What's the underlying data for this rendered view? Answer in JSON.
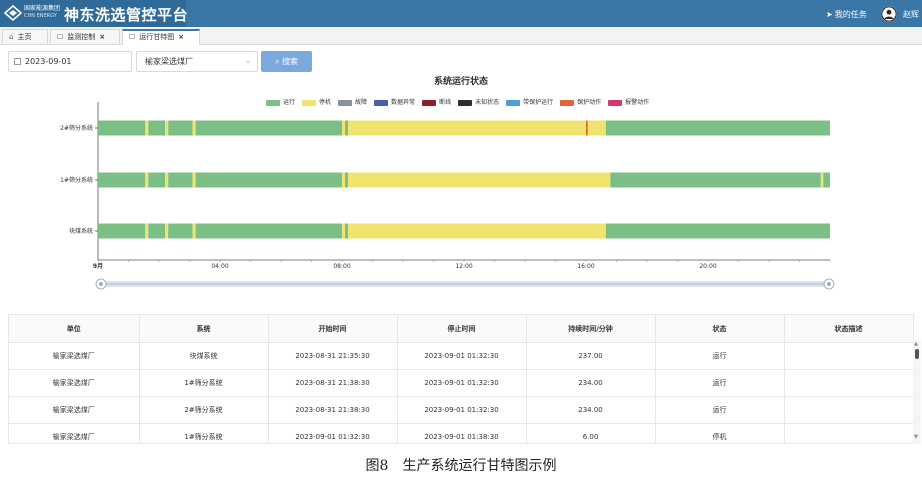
{
  "header": {
    "logo_cn": "国家能源集团",
    "logo_en": "CHN ENERGY",
    "app_title": "神东洗选管控平台",
    "tasks_label": "我的任务",
    "username": "赵辉"
  },
  "tabs": [
    {
      "label": "主页",
      "icon": "home-icon",
      "closable": false,
      "active": false
    },
    {
      "label": "监测控制",
      "icon": "page-icon",
      "closable": true,
      "active": false
    },
    {
      "label": "运行甘特图",
      "icon": "page-icon",
      "closable": true,
      "active": true
    }
  ],
  "filters": {
    "date_value": "2023-09-01",
    "plant_value": "榆家梁选煤厂",
    "search_label": "搜索"
  },
  "colors": {
    "header_bg": "#3a77a7",
    "running": "#7bbf86",
    "stopped": "#f0e36e",
    "fault": "#8a9299",
    "data_error": "#4a5ea8",
    "broken_line": "#8b1c2c",
    "unknown": "#2e2e33",
    "protect_running": "#4a9fdc",
    "protect_action": "#e0633a",
    "alarm_action": "#d13a6a",
    "button": "#79a9dd"
  },
  "chart_data": {
    "type": "gantt",
    "title": "系统运行状态",
    "legend": [
      {
        "name": "运行",
        "color": "#7bbf86"
      },
      {
        "name": "停机",
        "color": "#f0e36e"
      },
      {
        "name": "故障",
        "color": "#8a9299"
      },
      {
        "name": "数据异常",
        "color": "#4a5ea8"
      },
      {
        "name": "断线",
        "color": "#8b1c2c"
      },
      {
        "name": "未知状态",
        "color": "#2e2e33"
      },
      {
        "name": "带保护运行",
        "color": "#4a9fdc"
      },
      {
        "name": "保护动作",
        "color": "#e0633a"
      },
      {
        "name": "报警动作",
        "color": "#d13a6a"
      }
    ],
    "x_range_hours": [
      0,
      24
    ],
    "x_ticks": [
      {
        "hour": 0,
        "label": "9月"
      },
      {
        "hour": 4,
        "label": "04:00"
      },
      {
        "hour": 8,
        "label": "08:00"
      },
      {
        "hour": 12,
        "label": "12:00"
      },
      {
        "hour": 16,
        "label": "16:00"
      },
      {
        "hour": 20,
        "label": "20:00"
      }
    ],
    "systems": [
      {
        "name": "2#筛分系统",
        "segments": [
          {
            "start": 0,
            "end": 1.55,
            "status": "running"
          },
          {
            "start": 1.55,
            "end": 1.65,
            "status": "stopped"
          },
          {
            "start": 1.65,
            "end": 2.2,
            "status": "running"
          },
          {
            "start": 2.2,
            "end": 2.3,
            "status": "stopped"
          },
          {
            "start": 2.3,
            "end": 3.1,
            "status": "running"
          },
          {
            "start": 3.1,
            "end": 3.2,
            "status": "stopped"
          },
          {
            "start": 3.2,
            "end": 8.0,
            "status": "running"
          },
          {
            "start": 8.0,
            "end": 8.1,
            "status": "stopped"
          },
          {
            "start": 8.1,
            "end": 8.2,
            "status": "running"
          },
          {
            "start": 8.2,
            "end": 16.0,
            "status": "stopped"
          },
          {
            "start": 16.0,
            "end": 16.06,
            "status": "protect_action"
          },
          {
            "start": 16.06,
            "end": 16.65,
            "status": "stopped"
          },
          {
            "start": 16.65,
            "end": 24.0,
            "status": "running"
          }
        ]
      },
      {
        "name": "1#筛分系统",
        "segments": [
          {
            "start": 0,
            "end": 1.55,
            "status": "running"
          },
          {
            "start": 1.55,
            "end": 1.65,
            "status": "stopped"
          },
          {
            "start": 1.65,
            "end": 2.2,
            "status": "running"
          },
          {
            "start": 2.2,
            "end": 2.3,
            "status": "stopped"
          },
          {
            "start": 2.3,
            "end": 3.1,
            "status": "running"
          },
          {
            "start": 3.1,
            "end": 3.2,
            "status": "stopped"
          },
          {
            "start": 3.2,
            "end": 8.0,
            "status": "running"
          },
          {
            "start": 8.0,
            "end": 8.1,
            "status": "stopped"
          },
          {
            "start": 8.1,
            "end": 8.2,
            "status": "running"
          },
          {
            "start": 8.2,
            "end": 16.8,
            "status": "stopped"
          },
          {
            "start": 16.8,
            "end": 23.7,
            "status": "running"
          },
          {
            "start": 23.7,
            "end": 23.78,
            "status": "stopped"
          },
          {
            "start": 23.78,
            "end": 24.0,
            "status": "running"
          }
        ]
      },
      {
        "name": "块煤系统",
        "segments": [
          {
            "start": 0,
            "end": 1.55,
            "status": "running"
          },
          {
            "start": 1.55,
            "end": 1.65,
            "status": "stopped"
          },
          {
            "start": 1.65,
            "end": 2.2,
            "status": "running"
          },
          {
            "start": 2.2,
            "end": 2.3,
            "status": "stopped"
          },
          {
            "start": 2.3,
            "end": 3.1,
            "status": "running"
          },
          {
            "start": 3.1,
            "end": 3.2,
            "status": "stopped"
          },
          {
            "start": 3.2,
            "end": 8.0,
            "status": "running"
          },
          {
            "start": 8.0,
            "end": 8.1,
            "status": "stopped"
          },
          {
            "start": 8.1,
            "end": 8.2,
            "status": "running"
          },
          {
            "start": 8.2,
            "end": 16.65,
            "status": "stopped"
          },
          {
            "start": 16.65,
            "end": 24.0,
            "status": "running"
          }
        ]
      }
    ]
  },
  "table": {
    "columns": [
      "单位",
      "系统",
      "开始时间",
      "停止时间",
      "持续时间/分钟",
      "状态",
      "状态描述"
    ],
    "rows": [
      [
        "榆家梁选煤厂",
        "块煤系统",
        "2023-08-31 21:35:30",
        "2023-09-01 01:32:30",
        "237.00",
        "运行",
        ""
      ],
      [
        "榆家梁选煤厂",
        "1#筛分系统",
        "2023-08-31 21:38:30",
        "2023-09-01 01:32:30",
        "234.00",
        "运行",
        ""
      ],
      [
        "榆家梁选煤厂",
        "2#筛分系统",
        "2023-08-31 21:38:30",
        "2023-09-01 01:32:30",
        "234.00",
        "运行",
        ""
      ],
      [
        "榆家梁选煤厂",
        "1#筛分系统",
        "2023-09-01 01:32:30",
        "2023-09-01 01:38:30",
        "6.00",
        "停机",
        ""
      ]
    ]
  },
  "caption": "图8　生产系统运行甘特图示例"
}
